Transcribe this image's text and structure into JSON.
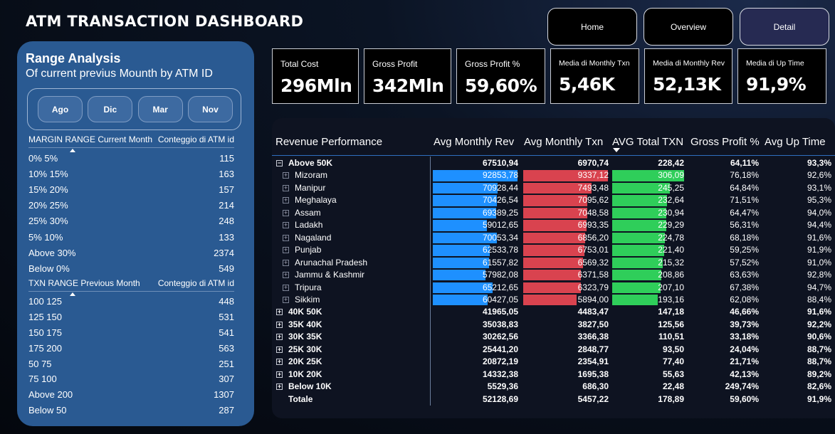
{
  "header": {
    "title": "ATM TRANSACTION DASHBOARD"
  },
  "nav": {
    "home": "Home",
    "overview": "Overview",
    "detail": "Detail"
  },
  "range": {
    "title": "Range Analysis",
    "subtitle": "Of current previus Mounth by ATM ID",
    "months": [
      "Ago",
      "Dic",
      "Mar",
      "Nov"
    ],
    "margin": {
      "col1": "MARGIN RANGE Current Month",
      "col2": "Conteggio di ATM id",
      "rows": [
        {
          "label": "0% 5%",
          "value": "115"
        },
        {
          "label": "10% 15%",
          "value": "163"
        },
        {
          "label": "15% 20%",
          "value": "157"
        },
        {
          "label": "20% 25%",
          "value": "214"
        },
        {
          "label": "25% 30%",
          "value": "248"
        },
        {
          "label": "5% 10%",
          "value": "133"
        },
        {
          "label": "Above 30%",
          "value": "2374"
        },
        {
          "label": "Below 0%",
          "value": "549"
        }
      ]
    },
    "txn": {
      "col1": "TXN RANGE Previous Month",
      "col2": "Conteggio di ATM id",
      "rows": [
        {
          "label": "100 125",
          "value": "448"
        },
        {
          "label": "125 150",
          "value": "531"
        },
        {
          "label": "150 175",
          "value": "541"
        },
        {
          "label": "175 200",
          "value": "563"
        },
        {
          "label": "50 75",
          "value": "251"
        },
        {
          "label": "75 100",
          "value": "307"
        },
        {
          "label": "Above 200",
          "value": "1307"
        },
        {
          "label": "Below 50",
          "value": "287"
        }
      ]
    }
  },
  "kpis": [
    {
      "label": "Total Cost",
      "value": "296Mln"
    },
    {
      "label": "Gross Profit",
      "value": "342Mln"
    },
    {
      "label": "Gross Profit %",
      "value": "59,60%"
    },
    {
      "label": "Media di Monthly Txn",
      "value": "5,46K"
    },
    {
      "label": "Media di Monthly Rev",
      "value": "52,13K"
    },
    {
      "label": "Media di Up Time",
      "value": "91,9%"
    }
  ],
  "matrix": {
    "headers": {
      "name": "Revenue Performance",
      "rev": "Avg Monthly Rev",
      "txn": "Avg Monthly Txn",
      "total": "AVG Total TXN",
      "gp": "Gross Profit %",
      "up": "Avg Up Time"
    },
    "colors": {
      "rev_bar": "#1e90ff",
      "txn_bar": "#d9434f",
      "total_bar": "#2fce5a"
    },
    "bar_max": {
      "rev": 92853.78,
      "txn": 9337.12,
      "total": 306.09
    },
    "rows": [
      {
        "level": 0,
        "expanded": true,
        "name": "Above 50K",
        "rev": "67510,94",
        "txn": "6970,74",
        "total": "228,42",
        "gp": "64,11%",
        "up": "93,3%"
      },
      {
        "level": 1,
        "name": "Mizoram",
        "rev": "92853,78",
        "txn": "9337,12",
        "total": "306,09",
        "gp": "76,18%",
        "up": "92,6%",
        "rv": 92853.78,
        "tv": 9337.12,
        "av": 306.09
      },
      {
        "level": 1,
        "name": "Manipur",
        "rev": "70928,44",
        "txn": "7493,48",
        "total": "245,25",
        "gp": "64,84%",
        "up": "93,1%",
        "rv": 70928.44,
        "tv": 7493.48,
        "av": 245.25
      },
      {
        "level": 1,
        "name": "Meghalaya",
        "rev": "70426,54",
        "txn": "7095,62",
        "total": "232,64",
        "gp": "71,51%",
        "up": "95,3%",
        "rv": 70426.54,
        "tv": 7095.62,
        "av": 232.64
      },
      {
        "level": 1,
        "name": "Assam",
        "rev": "69389,25",
        "txn": "7048,58",
        "total": "230,94",
        "gp": "64,47%",
        "up": "94,0%",
        "rv": 69389.25,
        "tv": 7048.58,
        "av": 230.94
      },
      {
        "level": 1,
        "name": "Ladakh",
        "rev": "59012,65",
        "txn": "6993,35",
        "total": "229,29",
        "gp": "56,31%",
        "up": "94,4%",
        "rv": 59012.65,
        "tv": 6993.35,
        "av": 229.29
      },
      {
        "level": 1,
        "name": "Nagaland",
        "rev": "70053,34",
        "txn": "6856,20",
        "total": "224,78",
        "gp": "68,18%",
        "up": "91,6%",
        "rv": 70053.34,
        "tv": 6856.2,
        "av": 224.78
      },
      {
        "level": 1,
        "name": "Punjab",
        "rev": "62533,78",
        "txn": "6753,01",
        "total": "221,40",
        "gp": "59,25%",
        "up": "91,9%",
        "rv": 62533.78,
        "tv": 6753.01,
        "av": 221.4
      },
      {
        "level": 1,
        "name": "Arunachal Pradesh",
        "rev": "61557,82",
        "txn": "6569,32",
        "total": "215,32",
        "gp": "57,52%",
        "up": "91,0%",
        "rv": 61557.82,
        "tv": 6569.32,
        "av": 215.32
      },
      {
        "level": 1,
        "name": "Jammu & Kashmir",
        "rev": "57982,08",
        "txn": "6371,58",
        "total": "208,86",
        "gp": "63,63%",
        "up": "92,8%",
        "rv": 57982.08,
        "tv": 6371.58,
        "av": 208.86
      },
      {
        "level": 1,
        "name": "Tripura",
        "rev": "65212,65",
        "txn": "6323,79",
        "total": "207,10",
        "gp": "67,38%",
        "up": "94,7%",
        "rv": 65212.65,
        "tv": 6323.79,
        "av": 207.1
      },
      {
        "level": 1,
        "name": "Sikkim",
        "rev": "60427,05",
        "txn": "5894,00",
        "total": "193,16",
        "gp": "62,08%",
        "up": "88,4%",
        "rv": 60427.05,
        "tv": 5894.0,
        "av": 193.16
      },
      {
        "level": 0,
        "expanded": false,
        "name": "40K 50K",
        "rev": "41965,05",
        "txn": "4483,47",
        "total": "147,18",
        "gp": "46,66%",
        "up": "91,6%"
      },
      {
        "level": 0,
        "expanded": false,
        "name": "35K 40K",
        "rev": "35038,83",
        "txn": "3827,50",
        "total": "125,56",
        "gp": "39,73%",
        "up": "92,2%"
      },
      {
        "level": 0,
        "expanded": false,
        "name": "30K 35K",
        "rev": "30262,56",
        "txn": "3366,38",
        "total": "110,51",
        "gp": "33,18%",
        "up": "90,6%"
      },
      {
        "level": 0,
        "expanded": false,
        "name": "25K 30K",
        "rev": "25441,20",
        "txn": "2848,77",
        "total": "93,50",
        "gp": "24,04%",
        "up": "88,7%"
      },
      {
        "level": 0,
        "expanded": false,
        "name": "20K 25K",
        "rev": "20872,19",
        "txn": "2354,91",
        "total": "77,40",
        "gp": "21,71%",
        "up": "88,7%"
      },
      {
        "level": 0,
        "expanded": false,
        "name": "10K 20K",
        "rev": "14332,38",
        "txn": "1695,38",
        "total": "55,63",
        "gp": "42,13%",
        "up": "89,2%"
      },
      {
        "level": 0,
        "expanded": false,
        "name": "Below 10K",
        "rev": "5529,36",
        "txn": "686,30",
        "total": "22,48",
        "gp": "249,74%",
        "up": "82,6%"
      },
      {
        "level": -1,
        "name": "Totale",
        "rev": "52128,69",
        "txn": "5457,22",
        "total": "178,89",
        "gp": "59,60%",
        "up": "91,9%"
      }
    ]
  }
}
